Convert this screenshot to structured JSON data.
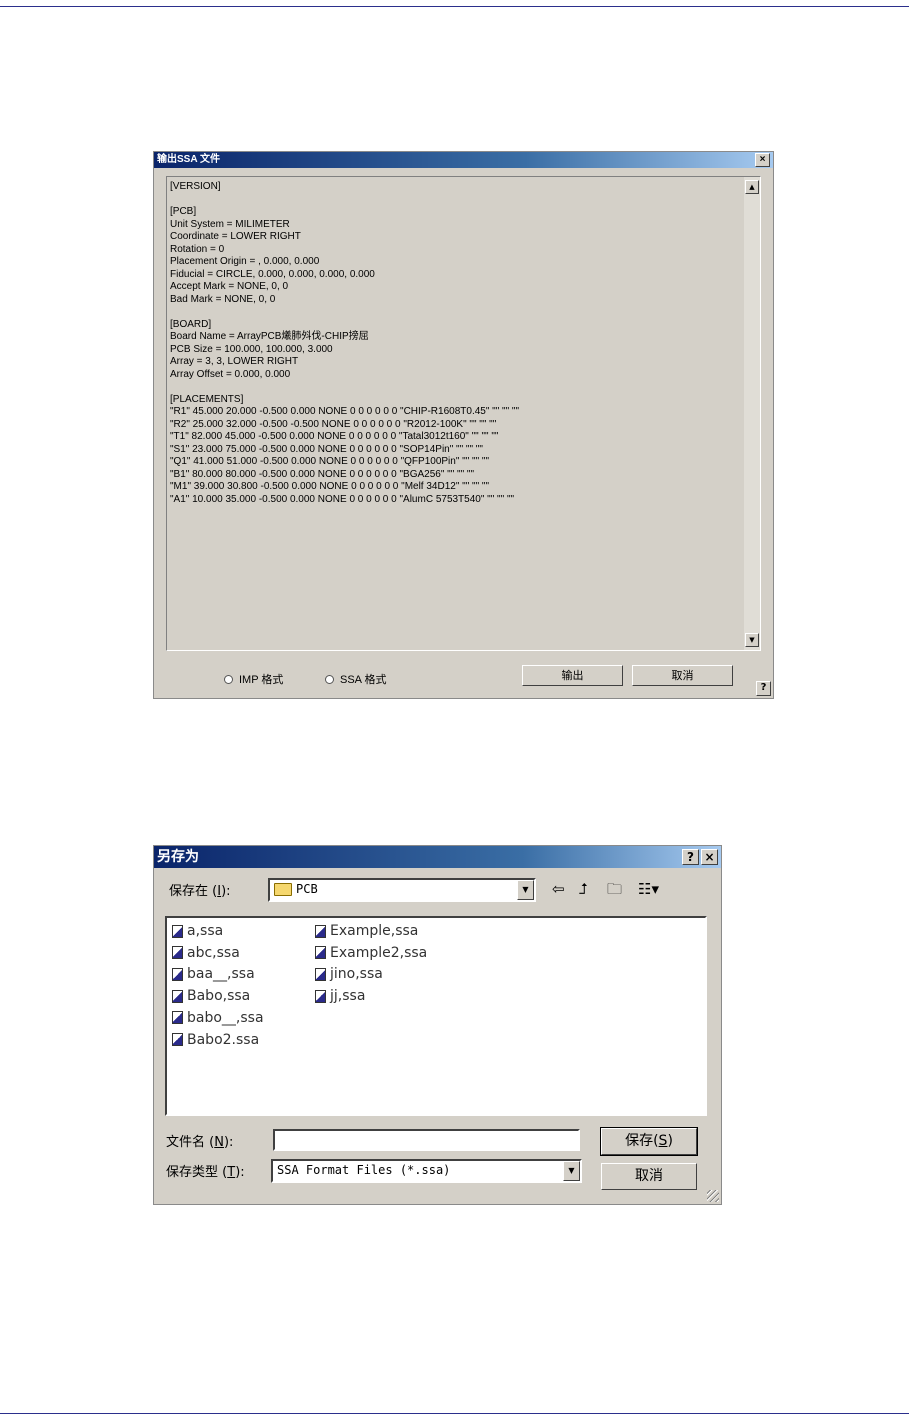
{
  "export_dialog": {
    "title": "输出SSA 文件",
    "close": "×",
    "content_lines": [
      "[VERSION]",
      "",
      "[PCB]",
      "Unit System = MILIMETER",
      "Coordinate = LOWER RIGHT",
      "Rotation = 0",
      "Placement Origin = , 0.000, 0.000",
      "Fiducial = CIRCLE, 0.000, 0.000, 0.000, 0.000",
      "Accept Mark = NONE, 0, 0",
      "Bad Mark = NONE, 0, 0",
      "",
      "[BOARD]",
      "Board Name = ArrayPCB爔肺斘伐-CHIP搒屈",
      "PCB Size = 100.000, 100.000, 3.000",
      "Array = 3, 3, LOWER RIGHT",
      "Array Offset = 0.000, 0.000",
      "",
      "[PLACEMENTS]",
      "\"R1\" 45.000 20.000 -0.500 0.000 NONE 0 0 0 0 0 0 \"CHIP-R1608T0.45\" \"\" \"\" \"\"",
      "\"R2\" 25.000 32.000 -0.500 -0.500 NONE 0 0 0 0 0 0 \"R2012-100K\" \"\" \"\" \"\"",
      "\"T1\" 82.000 45.000 -0.500 0.000 NONE 0 0 0 0 0 0 \"Tatal3012t160\" \"\" \"\" \"\"",
      "\"S1\" 23.000 75.000 -0.500 0.000 NONE 0 0 0 0 0 0 \"SOP14Pin\" \"\" \"\" \"\"",
      "\"Q1\" 41.000 51.000 -0.500 0.000 NONE 0 0 0 0 0 0 \"QFP100Pin\" \"\" \"\" \"\"",
      "\"B1\" 80.000 80.000 -0.500 0.000 NONE 0 0 0 0 0 0 \"BGA256\" \"\" \"\" \"\"",
      "\"M1\" 39.000 30.800 -0.500 0.000 NONE 0 0 0 0 0 0 \"Melf 34D12\" \"\" \"\" \"\"",
      "\"A1\" 10.000 35.000 -0.500 0.000 NONE 0 0 0 0 0 0 \"AlumC 5753T540\" \"\" \"\" \"\""
    ],
    "radio_imp": "IMP 格式",
    "radio_ssa": "SSA 格式",
    "output_button": "输出",
    "cancel_button": "取消",
    "help": "?"
  },
  "save_dialog": {
    "title": "另存为",
    "help": "?",
    "close": "×",
    "save_in_label": "保存在",
    "save_in_key": "I",
    "save_in_value": "PCB",
    "files_col1": [
      "a,ssa",
      "abc,ssa",
      "baa__,ssa",
      "Babo,ssa",
      "babo__,ssa",
      "Babo2.ssa"
    ],
    "files_col2": [
      "Example,ssa",
      "Example2,ssa",
      "jino,ssa",
      "jj,ssa"
    ],
    "filename_label": "文件名",
    "filename_key": "N",
    "filename_value": "",
    "filetype_label": "保存类型",
    "filetype_key": "T",
    "filetype_value": "SSA Format Files (*.ssa)",
    "save_button": "保存",
    "save_key": "S",
    "cancel_button": "取消"
  }
}
